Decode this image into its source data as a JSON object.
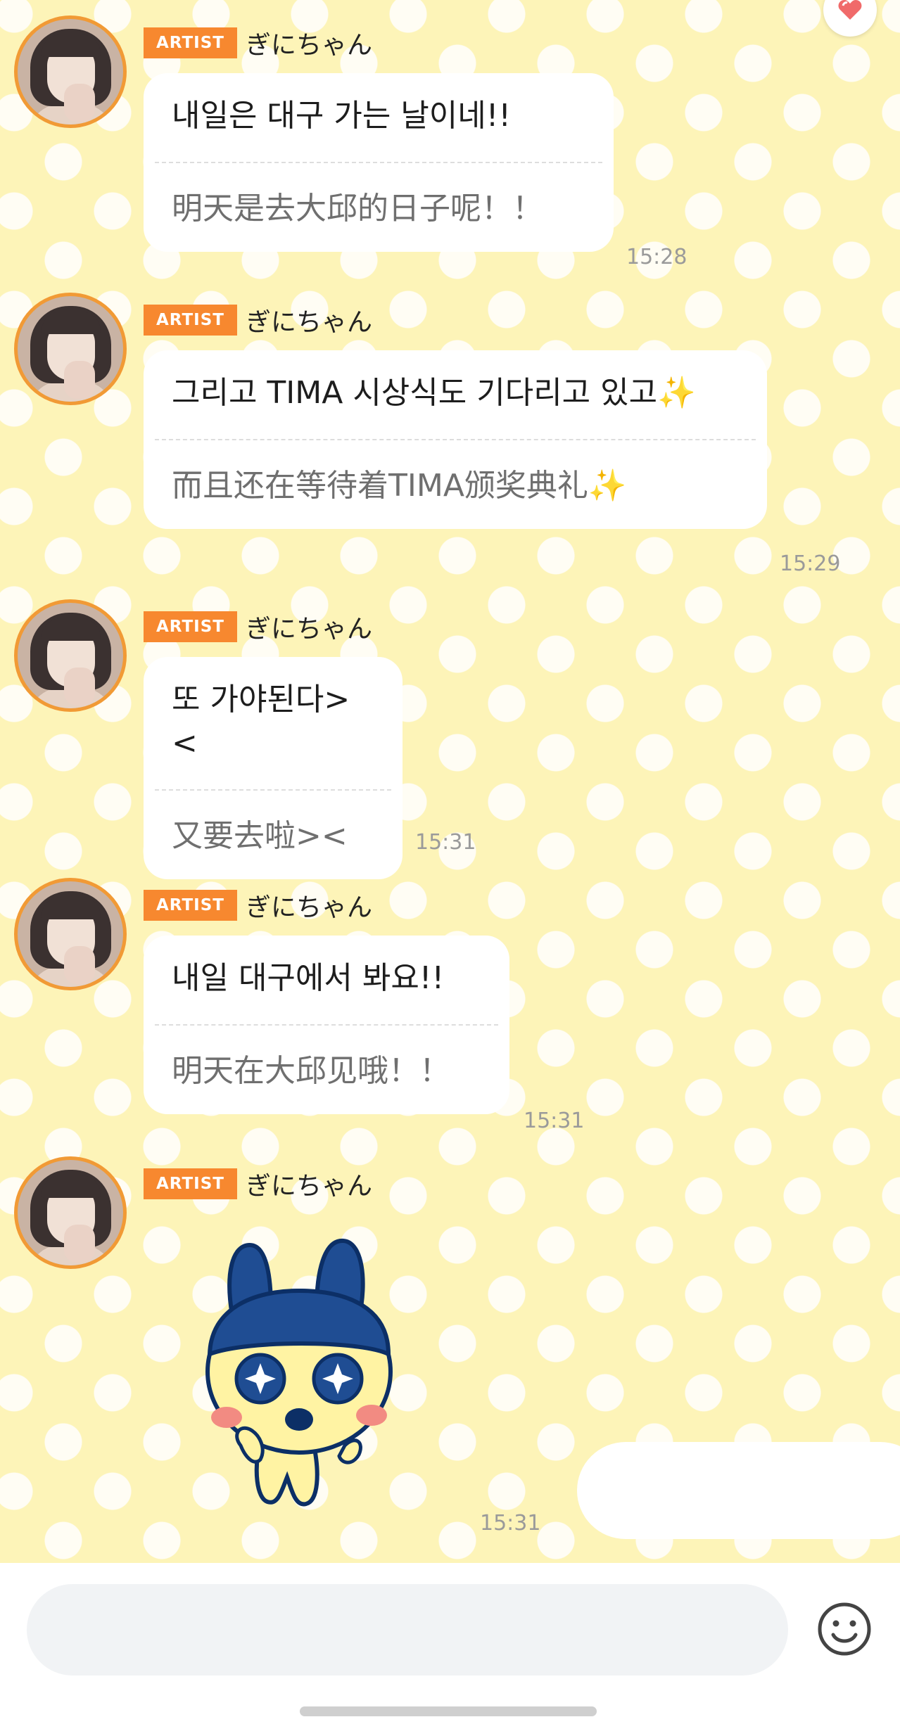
{
  "header": {
    "heart_icon": "heart-icon"
  },
  "messages": [
    {
      "badge": "ARTIST",
      "sender": "ぎにちゃん",
      "original": "내일은 대구 가는 날이네!!",
      "translation": "明天是去大邱的日子呢！！",
      "time": "15:28"
    },
    {
      "badge": "ARTIST",
      "sender": "ぎにちゃん",
      "original": "그리고 TIMA 시상식도 기다리고 있고✨",
      "translation": "而且还在等待着TIMA颁奖典礼✨",
      "time": "15:29"
    },
    {
      "badge": "ARTIST",
      "sender": "ぎにちゃん",
      "original": "또 가야된다><",
      "translation": "又要去啦><",
      "time": "15:31"
    },
    {
      "badge": "ARTIST",
      "sender": "ぎにちゃん",
      "original": "내일 대구에서 봐요!!",
      "translation": "明天在大邱见哦！！",
      "time": "15:31"
    },
    {
      "badge": "ARTIST",
      "sender": "ぎにちゃん",
      "sticker": "mametchi-sticker",
      "time": "15:31"
    }
  ],
  "composer": {
    "input_value": "",
    "placeholder": "",
    "emoji_icon": "smiley-icon"
  },
  "colors": {
    "badge": "#f7882f",
    "avatar_ring": "#f19a35",
    "background": "#fdf4b8",
    "bubble": "#ffffff"
  }
}
